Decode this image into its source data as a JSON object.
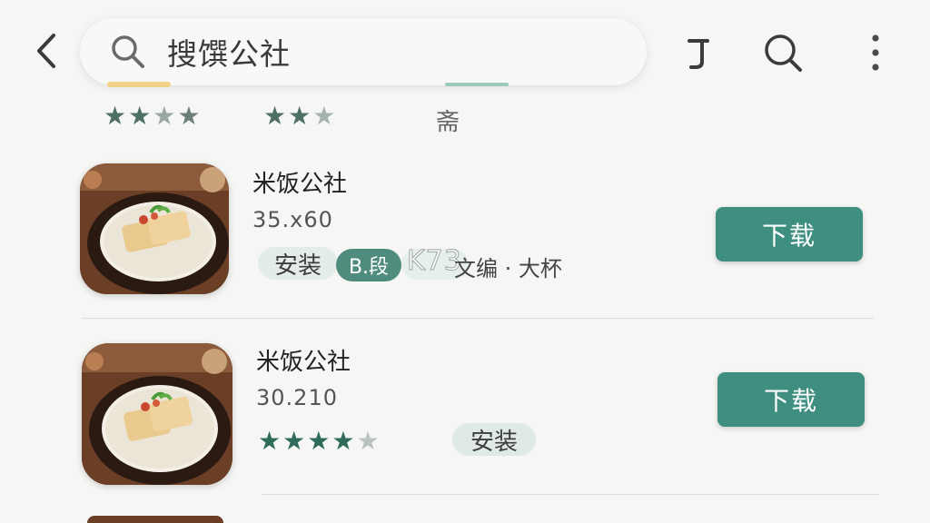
{
  "search": {
    "query": "搜馔公社"
  },
  "summary": {
    "tab_char": "斋"
  },
  "apps": [
    {
      "name": "米饭公社",
      "info": "35.x60",
      "install_label": "安装",
      "badge": "B.段",
      "watermark": "K73",
      "extra": "文编 · 大杯",
      "download_label": "下载"
    },
    {
      "name": "米饭公社",
      "info": "30.210",
      "install_label": "安装",
      "download_label": "下载"
    }
  ],
  "colors": {
    "accent": "#3f8f80",
    "star_dark": "#3c6b5f",
    "star_light": "#c9cfcd",
    "text": "#222222"
  }
}
